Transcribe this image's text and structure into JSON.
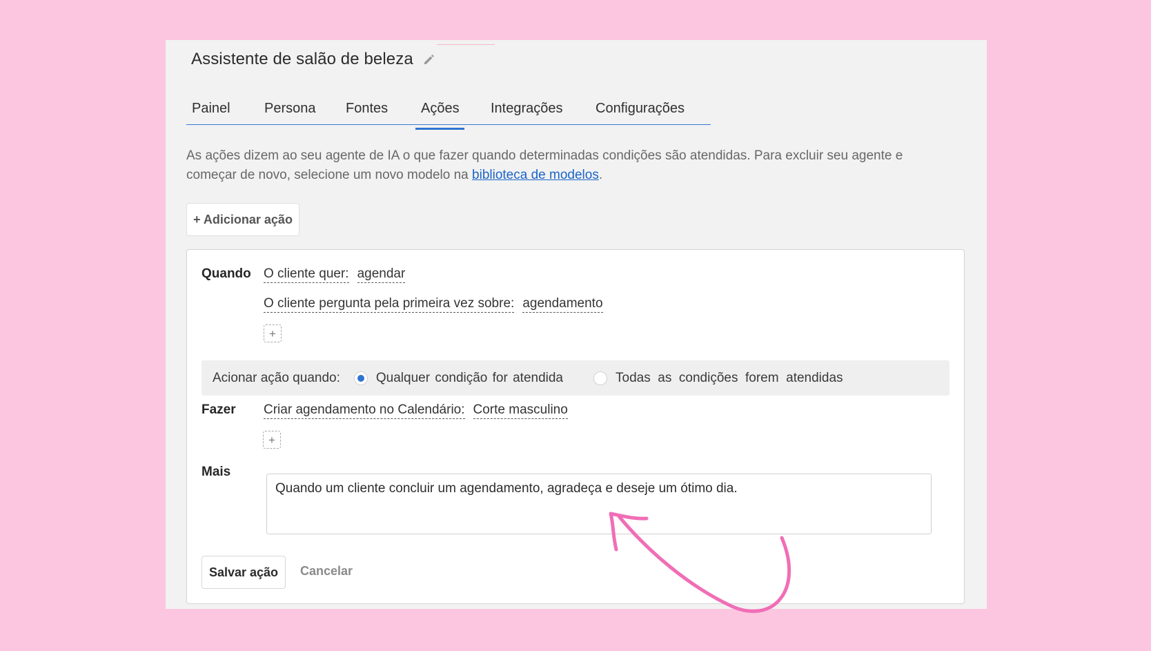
{
  "header": {
    "title": "Assistente de salão de beleza",
    "edit_icon": "pencil-icon"
  },
  "tabs": [
    {
      "label": "Painel"
    },
    {
      "label": "Persona"
    },
    {
      "label": "Fontes"
    },
    {
      "label": "Ações",
      "active": true
    },
    {
      "label": "Integrações"
    },
    {
      "label": "Configurações"
    }
  ],
  "description": {
    "text": "As ações dizem ao seu agente de IA o que fazer quando determinadas condições são atendidas. Para excluir seu agente e começar de novo, selecione um novo modelo na ",
    "link": "biblioteca de modelos",
    "suffix": "."
  },
  "add_action_label": "+ Adicionar ação",
  "action": {
    "when_label": "Quando",
    "conditions": [
      {
        "key": "O cliente quer:",
        "value": "agendar"
      },
      {
        "key": "O cliente pergunta pela primeira vez sobre:",
        "value": "agendamento"
      }
    ],
    "add_symbol": "+",
    "trigger": {
      "label": "Acionar ação quando:",
      "options": [
        "Qualquer condição for atendida",
        "Todas  as  condições  forem  atendidas"
      ],
      "selected": "Qualquer condição for atendida"
    },
    "do_label": "Fazer",
    "do": {
      "key": "Criar agendamento no Calendário:",
      "value": "Corte masculino"
    },
    "more_label": "Mais",
    "more_text": "Quando um cliente concluir um agendamento, agradeça e deseje um ótimo dia.",
    "save_label": "Salvar ação",
    "cancel_label": "Cancelar"
  },
  "colors": {
    "background": "#fdc6e0",
    "accent": "#2f74d0",
    "link": "#1a64c8",
    "annotation_arrow": "#f06eb6"
  }
}
